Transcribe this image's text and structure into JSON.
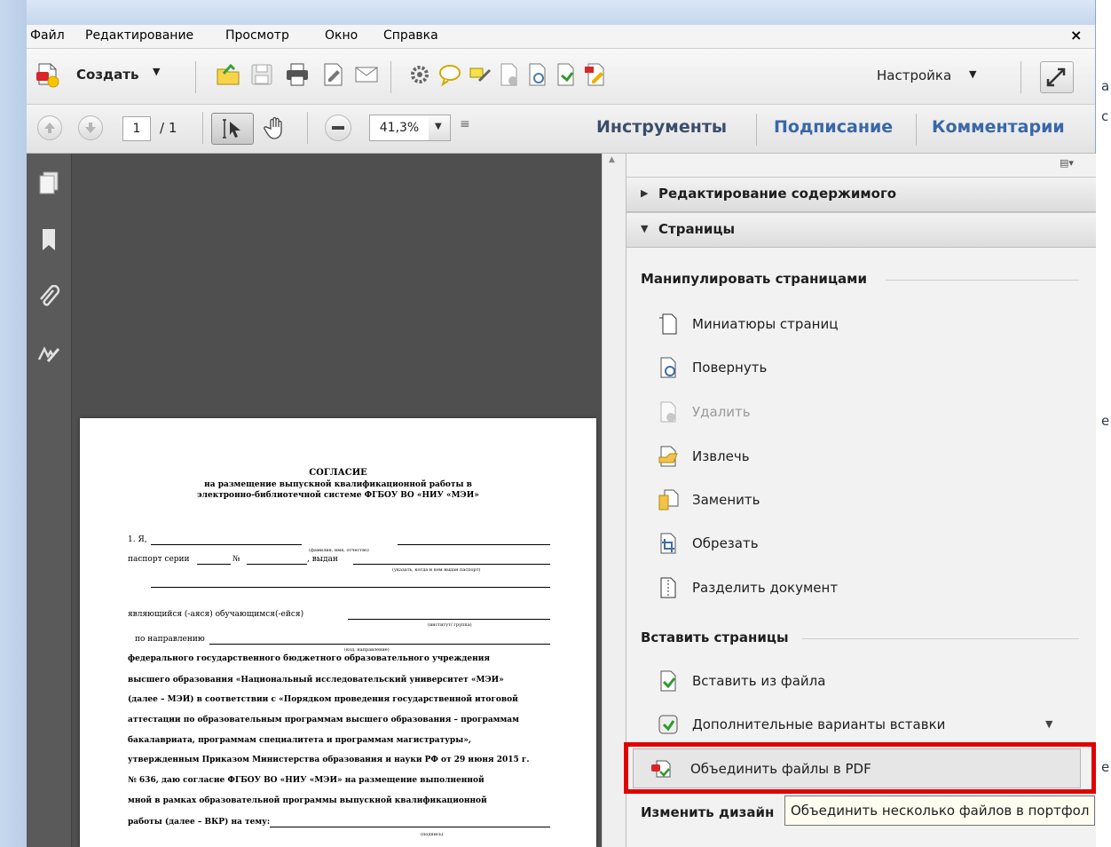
{
  "menu": {
    "items": [
      "Файл",
      "Редактирование",
      "Просмотр",
      "Окно",
      "Справка"
    ],
    "close": "×"
  },
  "toolbar": {
    "create_label": "Создать",
    "settings_label": "Настройка",
    "page_current": "1",
    "page_total": "/ 1",
    "zoom": "41,3%",
    "tabs": [
      "Инструменты",
      "Подписание",
      "Комментарии"
    ]
  },
  "panel": {
    "sections": [
      {
        "label": "Редактирование содержимого",
        "expanded": false
      },
      {
        "label": "Страницы",
        "expanded": true
      }
    ],
    "groups": {
      "manipulate": {
        "title": "Манипулировать страницами",
        "items": [
          {
            "label": "Миниатюры страниц",
            "icon": "page-thumbnails-icon",
            "enabled": true
          },
          {
            "label": "Повернуть",
            "icon": "rotate-icon",
            "enabled": true
          },
          {
            "label": "Удалить",
            "icon": "delete-page-icon",
            "enabled": false
          },
          {
            "label": "Извлечь",
            "icon": "extract-icon",
            "enabled": true
          },
          {
            "label": "Заменить",
            "icon": "replace-icon",
            "enabled": true
          },
          {
            "label": "Обрезать",
            "icon": "crop-icon",
            "enabled": true
          },
          {
            "label": "Разделить документ",
            "icon": "split-icon",
            "enabled": true
          }
        ]
      },
      "insert": {
        "title": "Вставить страницы",
        "items": [
          {
            "label": "Вставить из файла",
            "icon": "insert-file-icon"
          },
          {
            "label": "Дополнительные варианты вставки",
            "icon": "more-insert-icon"
          },
          {
            "label": "Объединить файлы в PDF",
            "icon": "combine-files-icon"
          }
        ]
      },
      "design": {
        "title": "Изменить дизайн"
      }
    },
    "tooltip": "Объединить несколько файлов в портфол"
  },
  "document": {
    "title": "СОГЛАСИЕ",
    "subtitle1": "на размещение выпускной квалификационной работы в",
    "subtitle2": "электронно-библиотечной системе ФГБОУ ВО «НИУ «МЭИ»",
    "l_ya": "1.  Я,",
    "fio_note": "(фамилия, имя, отчество)",
    "passport": "паспорт серии",
    "num": "№",
    "issued": ", выдан",
    "issued_note": "(указать, когда и кем выдан паспорт)",
    "student": "являющийся (-аяся) обучающимся(-ейся)",
    "group_note": "(институт/ группа)",
    "direction": "по направлению",
    "direction_note": "(код, направление)",
    "para": [
      "федерального   государственного   бюджетного   образовательного   учреждения",
      "высшего образования «Национальный исследовательский университет «МЭИ»",
      "(далее – МЭИ) в соответствии с «Порядком проведения государственной итоговой",
      "аттестации по образовательным программам высшего образования – программам",
      "бакалавриата,  программам  специалитета  и  программам  магистратуры»,",
      "утвержденным Приказом Министерства образования и науки РФ от 29 июня 2015 г.",
      "№ 636, даю согласие ФГБОУ ВО «НИУ «МЭИ» на размещение выполненной",
      "мной в рамках образовательной программы выпускной квалификационной",
      "работы (далее – ВКР) на тему:"
    ],
    "topic_note": "(подпись)"
  },
  "right_edge": [
    "а",
    "с",
    "е",
    "е"
  ],
  "colors": {
    "highlight": "#e00000",
    "tab_blue": "#3868a8"
  }
}
